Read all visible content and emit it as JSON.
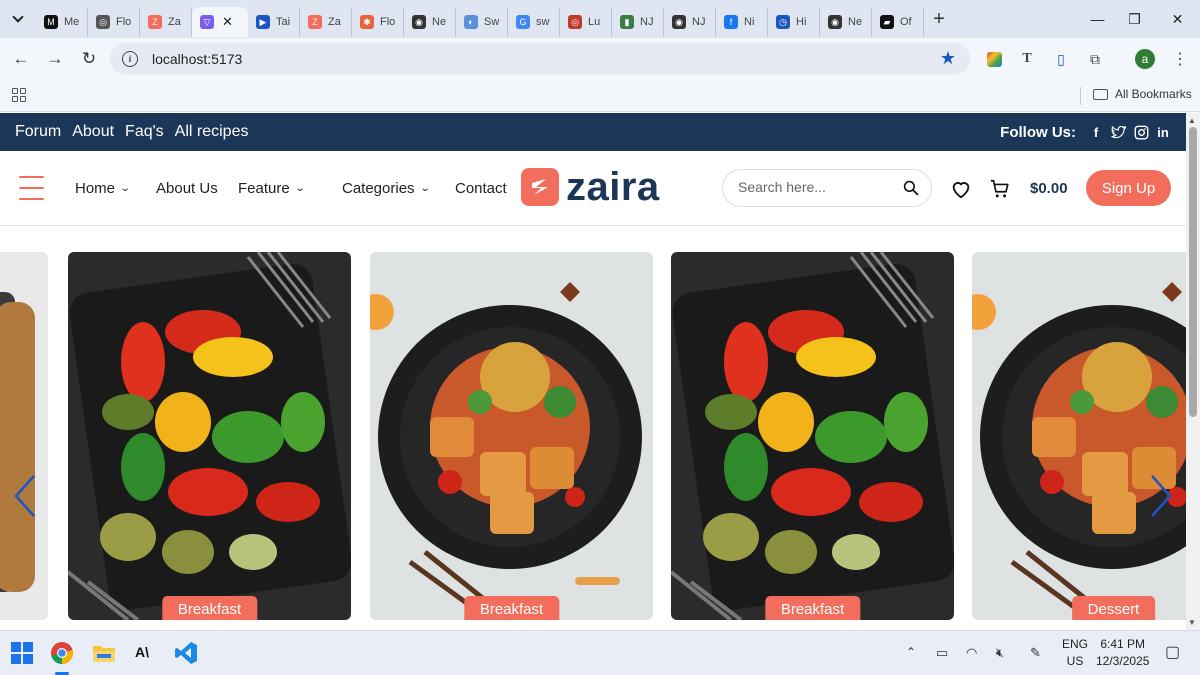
{
  "browser": {
    "tabs": [
      {
        "label": "Me",
        "color": "#111111",
        "glyph": "M"
      },
      {
        "label": "Flo",
        "color": "#555555",
        "glyph": "◎"
      },
      {
        "label": "Za",
        "color": "#f26d5b",
        "glyph": "Z"
      },
      {
        "label": "",
        "color": "#7b5cf0",
        "glyph": "▽",
        "active": true
      },
      {
        "label": "Tai",
        "color": "#1a56c4",
        "glyph": "▶"
      },
      {
        "label": "Za",
        "color": "#f26d5b",
        "glyph": "Z"
      },
      {
        "label": "Flo",
        "color": "#e8653a",
        "glyph": "✱"
      },
      {
        "label": "Ne",
        "color": "#333333",
        "glyph": "◉"
      },
      {
        "label": "Sw",
        "color": "#5b8fd9",
        "glyph": "◐"
      },
      {
        "label": "sw",
        "color": "#4285f4",
        "glyph": "G"
      },
      {
        "label": "Lu",
        "color": "#c0392b",
        "glyph": "◎"
      },
      {
        "label": "NJ",
        "color": "#3a7d44",
        "glyph": "▮"
      },
      {
        "label": "NJ",
        "color": "#333333",
        "glyph": "◉"
      },
      {
        "label": "Ni",
        "color": "#1877f2",
        "glyph": "f"
      },
      {
        "label": "Hi",
        "color": "#1a56c4",
        "glyph": "◷"
      },
      {
        "label": "Ne",
        "color": "#333333",
        "glyph": "◉"
      },
      {
        "label": "Of",
        "color": "#111111",
        "glyph": "▰"
      }
    ],
    "url": "localhost:5173",
    "profile_initial": "a",
    "all_bookmarks": "All Bookmarks"
  },
  "site": {
    "topbar": {
      "links": [
        "Forum",
        "About",
        "Faq's",
        "All recipes"
      ],
      "follow_label": "Follow Us:"
    },
    "nav": {
      "items": [
        {
          "label": "Home",
          "dropdown": true
        },
        {
          "label": "About Us",
          "dropdown": false
        },
        {
          "label": "Feature",
          "dropdown": true
        },
        {
          "label": "Categories",
          "dropdown": true
        },
        {
          "label": "Contact",
          "dropdown": false
        }
      ],
      "logo_text": "zaira",
      "search_placeholder": "Search here...",
      "cart_total": "$0.00",
      "signup_label": "Sign Up"
    },
    "carousel": {
      "cards": [
        {
          "category": "Breakfast",
          "dish": "grilled-vegetables"
        },
        {
          "category": "Breakfast",
          "dish": "tofu-bowl"
        },
        {
          "category": "Breakfast",
          "dish": "grilled-vegetables"
        },
        {
          "category": "Dessert",
          "dish": "tofu-bowl"
        }
      ]
    },
    "accent_color": "#f26d5b",
    "brand_color": "#1b3657"
  },
  "taskbar": {
    "language": "ENG",
    "region": "US",
    "time": "6:41 PM",
    "date": "12/3/2025"
  }
}
